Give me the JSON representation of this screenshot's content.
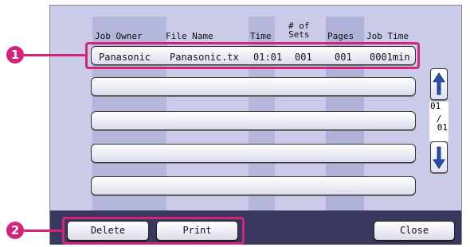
{
  "table": {
    "headers": {
      "job_owner": "Job Owner",
      "file_name": "File Name",
      "time": "Time",
      "sets": "# of\nSets",
      "pages": "Pages",
      "job_time": "Job Time"
    },
    "rows": [
      {
        "job_owner": "Panasonic",
        "file_name": "Panasonic.tx",
        "time": "01:01",
        "sets": "001",
        "pages": "001",
        "job_time": "0001min"
      },
      {
        "job_owner": "",
        "file_name": "",
        "time": "",
        "sets": "",
        "pages": "",
        "job_time": ""
      },
      {
        "job_owner": "",
        "file_name": "",
        "time": "",
        "sets": "",
        "pages": "",
        "job_time": ""
      },
      {
        "job_owner": "",
        "file_name": "",
        "time": "",
        "sets": "",
        "pages": "",
        "job_time": ""
      },
      {
        "job_owner": "",
        "file_name": "",
        "time": "",
        "sets": "",
        "pages": "",
        "job_time": ""
      }
    ]
  },
  "pager": {
    "current": "01",
    "separator": "/",
    "total": "01"
  },
  "buttons": {
    "delete": "Delete",
    "print": "Print",
    "close": "Close"
  },
  "callouts": [
    "1",
    "2"
  ],
  "colors": {
    "accent": "#d3247a",
    "screen": "#c9cbe8",
    "bar": "#38385e"
  },
  "icons": {
    "up": "arrow-up-icon",
    "down": "arrow-down-icon"
  }
}
